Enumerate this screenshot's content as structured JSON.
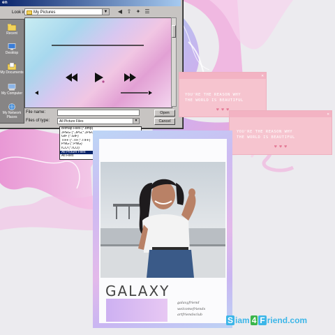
{
  "dialog": {
    "title": "en",
    "look_in_label": "Look in:",
    "look_in_value": "My Pictures",
    "places": [
      {
        "label": "Recent",
        "icon": "folder-icon"
      },
      {
        "label": "Desktop",
        "icon": "desktop-icon"
      },
      {
        "label": "My Documents",
        "icon": "documents-icon"
      },
      {
        "label": "My Computer",
        "icon": "computer-icon"
      },
      {
        "label": "My Network Places",
        "icon": "network-icon"
      }
    ],
    "file_name_label": "File name:",
    "file_name_value": "",
    "files_of_type_label": "Files of type:",
    "files_of_type_value": "All Picture Files",
    "open_button": "Open",
    "cancel_button": "Cancel",
    "type_options": [
      "Bitmap Files (*.bmp)",
      "JPEG (*.JPG;*.JPEG;*.JPE;*.JFIF)",
      "GIF (*.GIF)",
      "TIFF (*.TIF;*.TIFF)",
      "PNG (*.PNG)",
      "ICO (*.ICO)",
      "All Picture Files",
      "All Files"
    ],
    "selected_option": 6
  },
  "player": {
    "rewind_icon": "rewind-icon",
    "play_icon": "play-icon",
    "forward_icon": "fast-forward-icon"
  },
  "pink_windows": [
    {
      "lines": [
        "YOU'RE THE REASON WHY",
        "THE WORLD IS BEAUTIFUL"
      ],
      "hearts": "♥ ♥ ♥"
    },
    {
      "lines": [
        "YOU'RE THE REASON WHY",
        "THE WORLD IS BEAUTIFUL"
      ],
      "hearts": "♥ ♥ ♥"
    }
  ],
  "card": {
    "title": "GALAXY",
    "handles": [
      "galaxyfriend",
      "welcomefriends",
      "artfriendsclub"
    ]
  },
  "brand": {
    "s_box": "S",
    "iam": "iam",
    "four": "4",
    "f_box": "F",
    "riend": "riend",
    "domain": ".com"
  },
  "colors": {
    "accent_blue": "#0a246a",
    "pink_window": "#f6c4cf",
    "brand_blue": "#3cb6e8",
    "brand_green": "#39b54a"
  }
}
